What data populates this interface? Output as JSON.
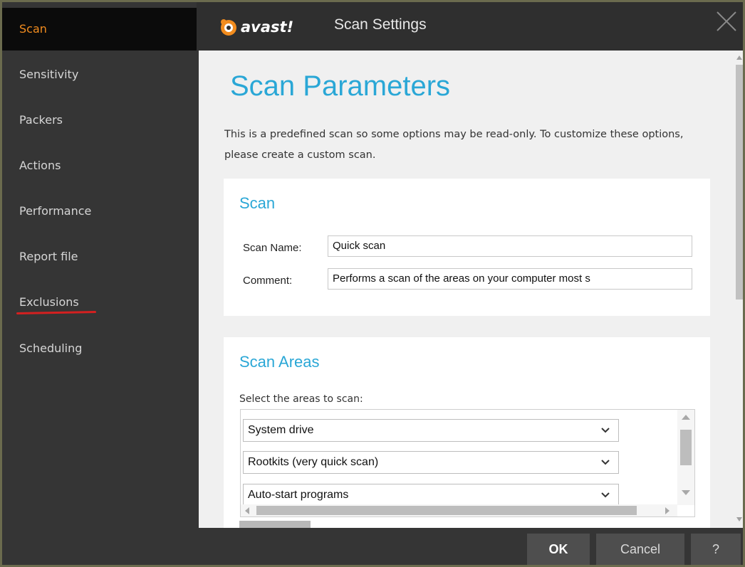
{
  "sidebar": {
    "items": [
      {
        "label": "Scan",
        "active": true
      },
      {
        "label": "Sensitivity"
      },
      {
        "label": "Packers"
      },
      {
        "label": "Actions"
      },
      {
        "label": "Performance"
      },
      {
        "label": "Report file"
      },
      {
        "label": "Exclusions"
      },
      {
        "label": "Scheduling"
      }
    ]
  },
  "header": {
    "brand": "avast!",
    "title": "Scan Settings",
    "close_icon": "close-icon"
  },
  "main": {
    "page_title": "Scan Parameters",
    "intro": "This is a predefined scan so some options may be read-only. To customize these options, please create a custom scan.",
    "scan_card": {
      "title": "Scan",
      "name_label": "Scan Name:",
      "name_value": "Quick scan",
      "comment_label": "Comment:",
      "comment_value": "Performs a scan of the areas on your computer most s"
    },
    "areas_card": {
      "title": "Scan Areas",
      "select_label": "Select the areas to scan:",
      "areas": [
        "System drive",
        "Rootkits (very quick scan)",
        "Auto-start programs"
      ]
    }
  },
  "footer": {
    "ok_label": "OK",
    "cancel_label": "Cancel",
    "help_label": "?"
  },
  "colors": {
    "accent": "#2aa7d6",
    "active_sidebar_text": "#f28c1e",
    "annotation_underline": "#d42020"
  }
}
